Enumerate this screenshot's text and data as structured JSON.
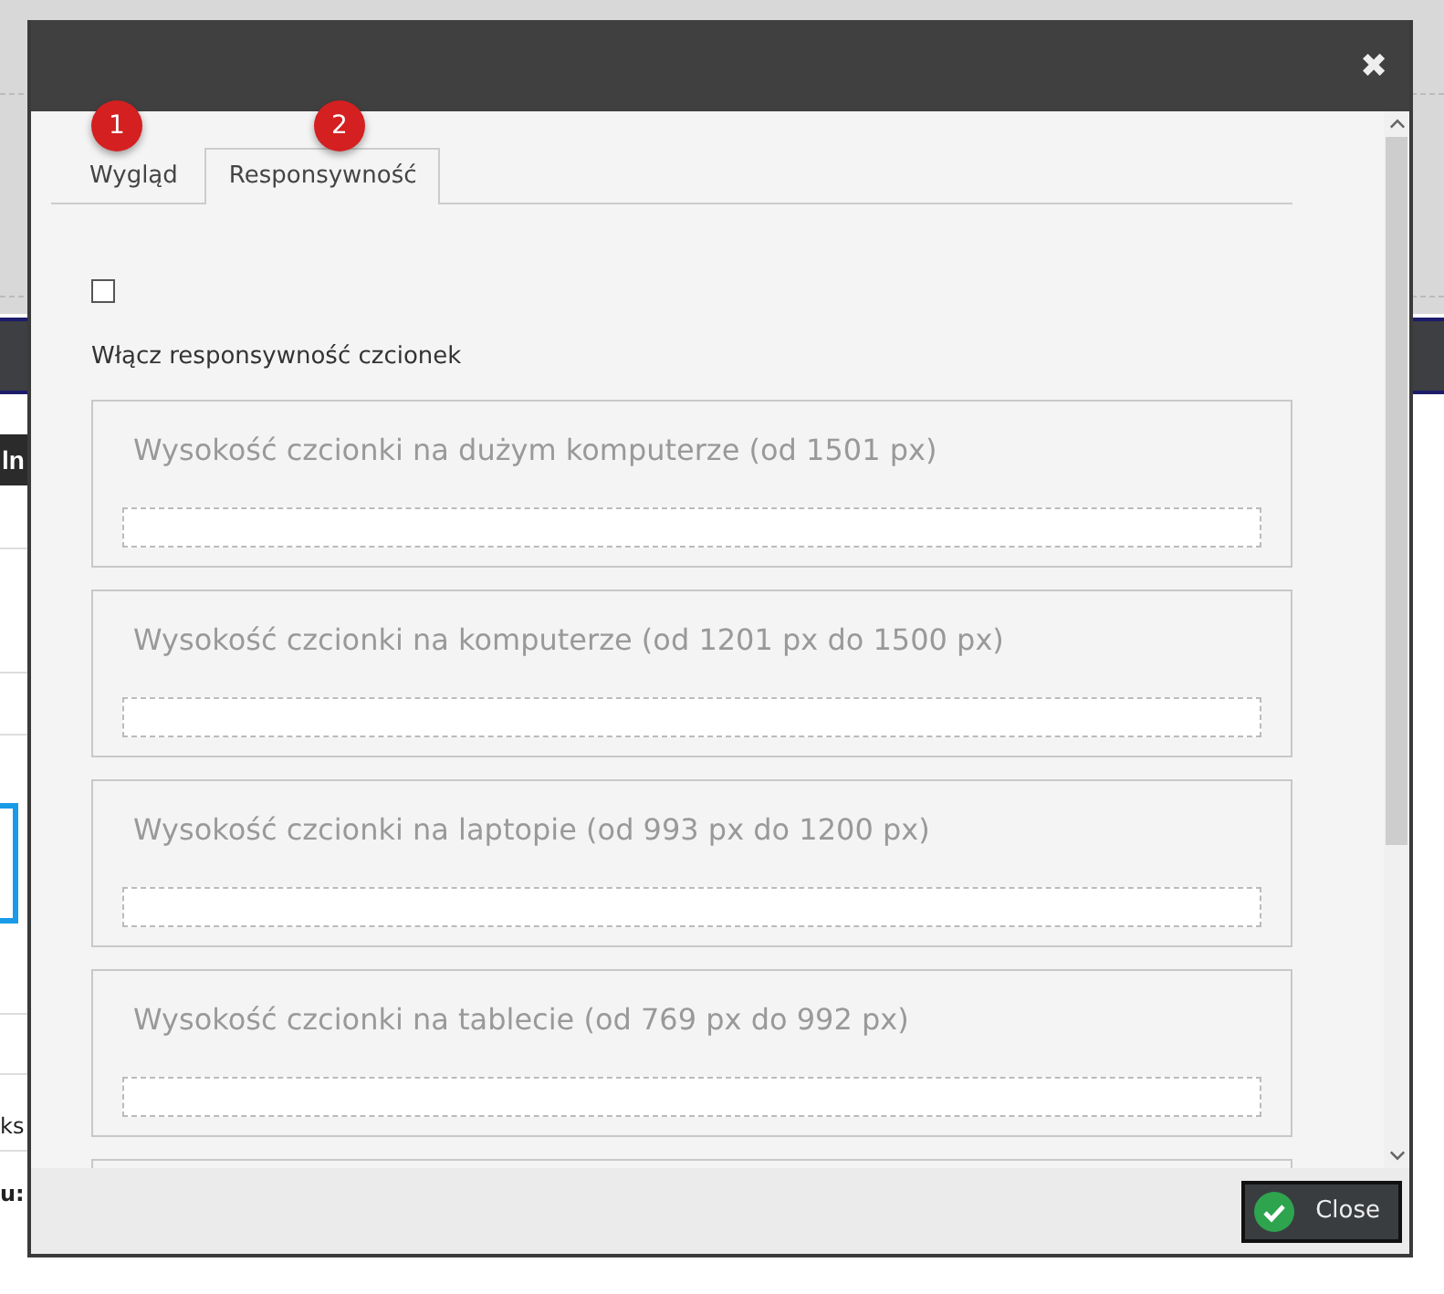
{
  "background_page": {
    "fragments": [
      "ln",
      "ks",
      "u:"
    ]
  },
  "dialog": {
    "close_icon": "✖",
    "badges": [
      "1",
      "2"
    ],
    "tabs": [
      {
        "label": "Wygląd",
        "selected": false
      },
      {
        "label": "Responsywność",
        "selected": true
      }
    ],
    "checkbox": {
      "checked": false
    },
    "checkbox_label": "Włącz responsywność czcionek",
    "fields": [
      {
        "label": "Wysokość czcionki na dużym komputerze (od 1501 px)"
      },
      {
        "label": "Wysokość czcionki na komputerze (od 1201 px do 1500 px)"
      },
      {
        "label": "Wysokość czcionki na laptopie (od 993 px do 1200 px)"
      },
      {
        "label": "Wysokość czcionki na tablecie (od 769 px do 992 px)"
      }
    ],
    "footer_button": "Close"
  }
}
